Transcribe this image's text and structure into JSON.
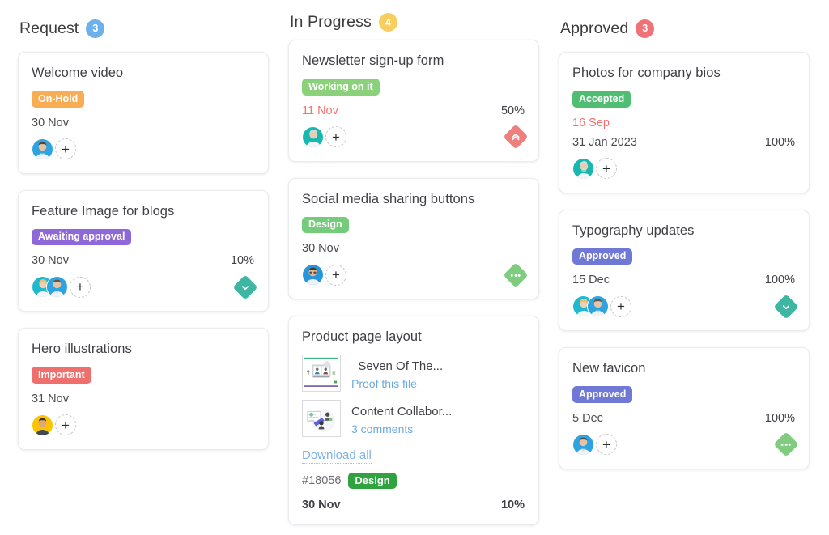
{
  "columns": [
    {
      "title": "Request",
      "count": "3",
      "count_color": "#6bb2ec",
      "cards": [
        {
          "title": "Welcome video",
          "tag": {
            "label": "On-Hold",
            "color": "#f9ad53"
          },
          "date": "30 Nov",
          "date_overdue": false,
          "percent": "",
          "avatars": [
            "male-blue",
            "none"
          ],
          "avatar_count": 1,
          "priority_icon": "",
          "priority_color": ""
        },
        {
          "title": "Feature Image for blogs",
          "tag": {
            "label": "Awaiting approval",
            "color": "#8e68d9"
          },
          "date": "30 Nov",
          "date_overdue": false,
          "percent": "10%",
          "avatar_count": 2,
          "priority_icon": "chevron-down",
          "priority_color": "#3eb6a2"
        },
        {
          "title": "Hero illustrations",
          "tag": {
            "label": "Important",
            "color": "#ee6f6c"
          },
          "date": "31 Nov",
          "date_overdue": false,
          "percent": "",
          "avatar_count": 1,
          "avatar_style": "yellow",
          "priority_icon": "",
          "priority_color": ""
        }
      ]
    },
    {
      "title": "In Progress",
      "count": "4",
      "count_color": "#f8cf5e",
      "cards": [
        {
          "title": "Newsletter sign-up form",
          "tag": {
            "label": "Working on it",
            "color": "#8bd17c"
          },
          "date": "11 Nov",
          "date_overdue": true,
          "percent": "50%",
          "avatar_count": 1,
          "avatar_style": "teal",
          "priority_icon": "chevrons-up",
          "priority_color": "#ef7f7d"
        },
        {
          "title": "Social media sharing buttons",
          "tag": {
            "label": "Design",
            "color": "#74cc7a"
          },
          "date": "30 Nov",
          "date_overdue": false,
          "percent": "",
          "avatar_count": 1,
          "avatar_style": "blue-glasses",
          "priority_icon": "dots",
          "priority_color": "#7fcc7f"
        },
        {
          "title": "Product page layout",
          "files": [
            {
              "name": "_Seven Of The...",
              "link": "Proof this file",
              "thumb": "proof-thumb"
            },
            {
              "name": "Content Collabor...",
              "link": "3 comments",
              "thumb": "collab-thumb"
            }
          ],
          "download_all": "Download all",
          "ticket_id": "#18056",
          "inline_tag": {
            "label": "Design",
            "color": "#30a23f"
          },
          "date": "30 Nov",
          "date_bold": true,
          "percent": "10%",
          "percent_bold": true
        }
      ]
    },
    {
      "title": "Approved",
      "count": "3",
      "count_color": "#ef7277",
      "cards": [
        {
          "title": "Photos for company bios",
          "tag": {
            "label": "Accepted",
            "color": "#4fbe72"
          },
          "sub_date": "16 Sep",
          "date": "31 Jan 2023",
          "date_overdue": false,
          "percent": "100%",
          "avatar_count": 1,
          "avatar_style": "senior-teal",
          "priority_icon": "",
          "priority_color": ""
        },
        {
          "title": "Typography updates",
          "tag": {
            "label": "Approved",
            "color": "#6f78d4"
          },
          "date": "15 Dec",
          "date_overdue": false,
          "percent": "100%",
          "avatar_count": 2,
          "priority_icon": "chevron-down",
          "priority_color": "#3eb6a2"
        },
        {
          "title": "New favicon",
          "tag": {
            "label": "Approved",
            "color": "#6f78d4"
          },
          "date": "5 Dec",
          "date_overdue": false,
          "percent": "100%",
          "avatar_count": 1,
          "avatar_style": "male-blue",
          "priority_icon": "dots",
          "priority_color": "#7fcc7f"
        }
      ]
    }
  ],
  "icons": {
    "add_person": "+",
    "chevron_down": "chevron-down-icon",
    "chevrons_up": "chevrons-up-icon",
    "dots": "more-dots-icon"
  }
}
